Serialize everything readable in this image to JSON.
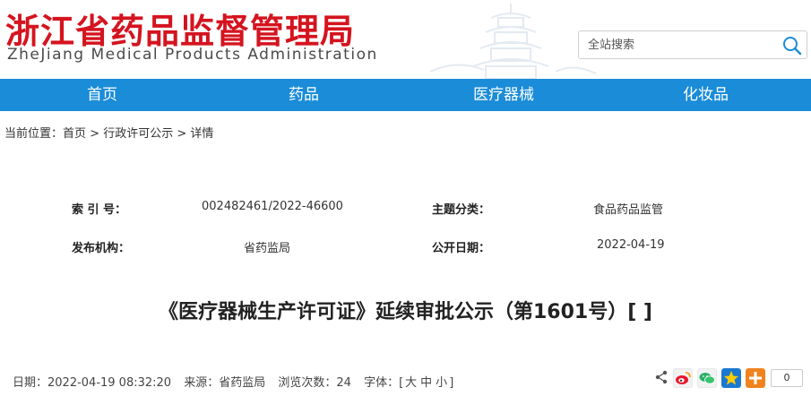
{
  "header": {
    "logo_cn": "浙江省药品监督管理局",
    "logo_en": "ZheJiang Medical Products Administration",
    "search_placeholder": "全站搜索"
  },
  "nav": {
    "items": [
      {
        "label": "首页"
      },
      {
        "label": "药品"
      },
      {
        "label": "医疗器械"
      },
      {
        "label": "化妆品"
      }
    ]
  },
  "breadcrumb": {
    "prefix": "当前位置：",
    "items": [
      "首页",
      "行政许可公示",
      "详情"
    ],
    "separator": ">"
  },
  "meta": {
    "index_label": "索 引 号：",
    "index_value": "002482461/2022-46600",
    "topic_label": "主题分类：",
    "topic_value": "食品药品监管",
    "publisher_label": "发布机构：",
    "publisher_value": "省药监局",
    "date_label": "公开日期：",
    "date_value": "2022-04-19"
  },
  "article": {
    "title": "《医疗器械生产许可证》延续审批公示（第1601号）[ ]"
  },
  "info_bar": {
    "date": "日期：2022-04-19 08:32:20",
    "source": "来源：省药监局",
    "views": "浏览次数：24",
    "font_label": "字体：[",
    "font_large": "大",
    "font_medium": "中",
    "font_small": "小",
    "font_end": "]"
  },
  "share": {
    "count": "0",
    "icons": [
      "share-icon",
      "weibo-icon",
      "wechat-icon",
      "qzone-icon",
      "more-icon"
    ]
  },
  "colors": {
    "brand_red": "#d4141f",
    "nav_blue": "#1a8cd8"
  }
}
